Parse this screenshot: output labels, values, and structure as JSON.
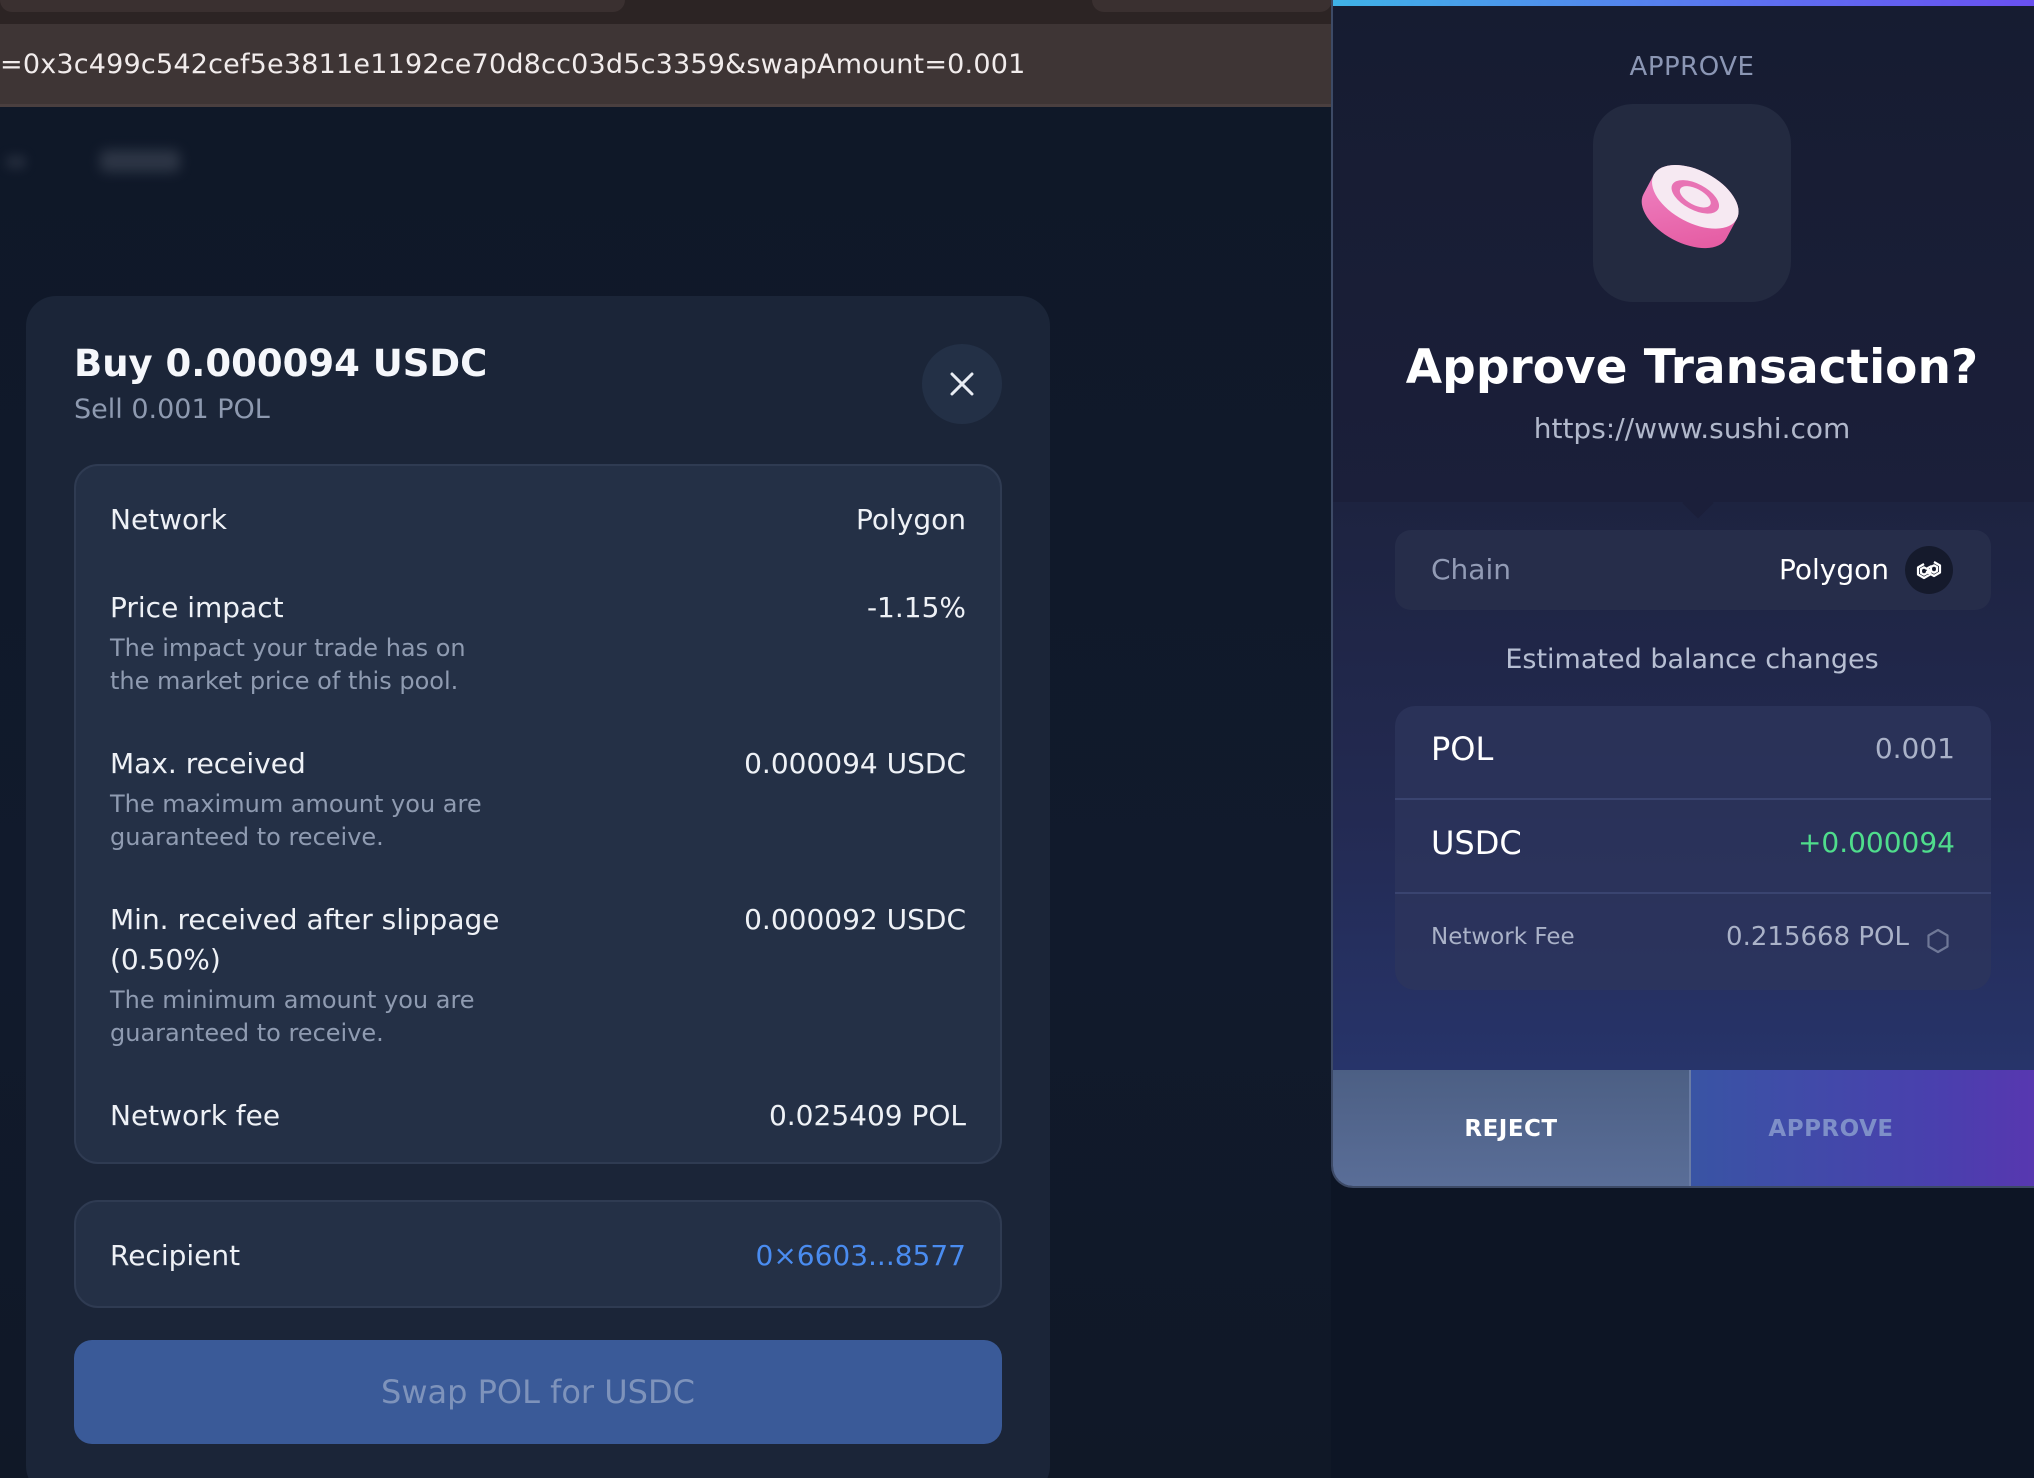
{
  "browser": {
    "url": "=0x3c499c542cef5e3811e1192ce70d8cc03d5c3359&swapAmount=0.001"
  },
  "swap": {
    "title": "Buy 0.000094 USDC",
    "subtitle": "Sell 0.001 POL",
    "details": [
      {
        "label": "Network",
        "value": "Polygon",
        "description": ""
      },
      {
        "label": "Price impact",
        "value": "-1.15%",
        "description": "The impact your trade has on the market price of this pool."
      },
      {
        "label": "Max. received",
        "value": "0.000094 USDC",
        "description": "The maximum amount you are guaranteed to receive."
      },
      {
        "label": "Min. received after slippage (0.50%)",
        "value": "0.000092 USDC",
        "description": "The minimum amount you are guaranteed to receive."
      },
      {
        "label": "Network fee",
        "value": "0.025409 POL",
        "description": ""
      }
    ],
    "recipient": {
      "label": "Recipient",
      "value": "0×6603...8577"
    },
    "swap_button": "Swap POL for USDC"
  },
  "wallet": {
    "kicker": "APPROVE",
    "logo_icon": "sushi-logo-icon",
    "title": "Approve Transaction?",
    "site": "https://www.sushi.com",
    "chain": {
      "label": "Chain",
      "value": "Polygon",
      "icon": "polygon-icon"
    },
    "estimated_label": "Estimated balance changes",
    "balances": [
      {
        "token": "POL",
        "amount": "0.001",
        "color": "#aab2c8"
      },
      {
        "token": "USDC",
        "amount": "+0.000094",
        "color": "#4fdd8c"
      }
    ],
    "fee": {
      "label": "Network Fee",
      "amount": "0.215668 POL",
      "icon": "gas-settings-icon"
    },
    "reject_label": "REJECT",
    "approve_label": "APPROVE"
  },
  "colors": {
    "accent_blue": "#4a8cf0",
    "positive_green": "#4fdd8c",
    "swap_button": "#3a5a98"
  }
}
